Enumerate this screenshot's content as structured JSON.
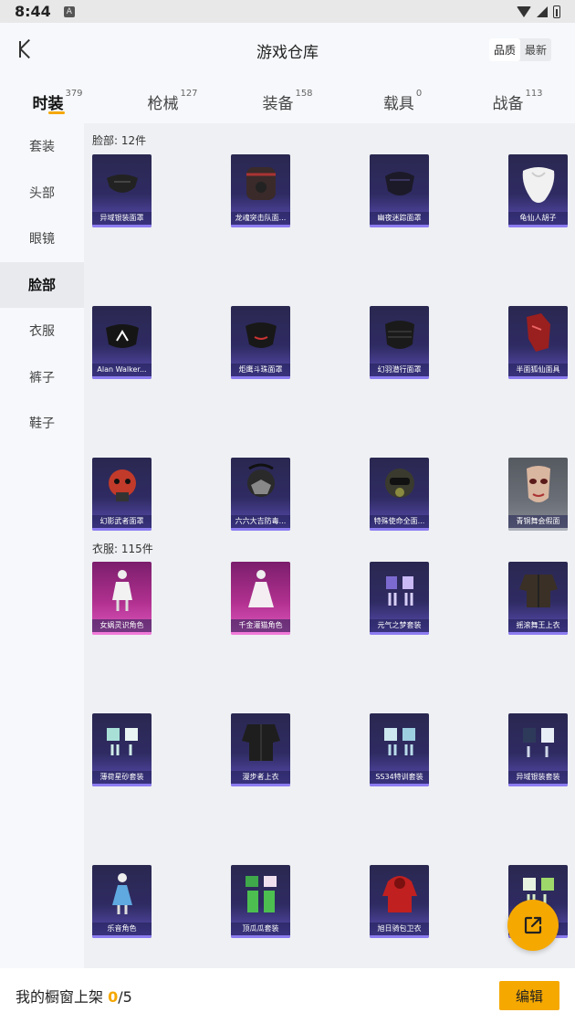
{
  "status": {
    "time": "8:44",
    "a_icon": "A"
  },
  "header": {
    "title": "游戏仓库",
    "sort_quality": "品质",
    "sort_newest": "最新"
  },
  "tabs": [
    {
      "label": "时装",
      "count": "379",
      "active": true
    },
    {
      "label": "枪械",
      "count": "127",
      "active": false
    },
    {
      "label": "装备",
      "count": "158",
      "active": false
    },
    {
      "label": "载具",
      "count": "0",
      "active": false
    },
    {
      "label": "战备",
      "count": "113",
      "active": false
    }
  ],
  "sidebar": [
    "套装",
    "头部",
    "眼镜",
    "脸部",
    "衣服",
    "裤子",
    "鞋子"
  ],
  "sidebar_active": "脸部",
  "sections": [
    {
      "title": "脸部: 12件"
    },
    {
      "title": "衣服: 115件"
    }
  ],
  "face_items": [
    {
      "name": "异域银装面罩",
      "icon": "black-half-mask",
      "rarity": "purple"
    },
    {
      "name": "龙魂突击队面...",
      "icon": "red-black-mask",
      "rarity": "purple"
    },
    {
      "name": "幽夜迷踪面罩",
      "icon": "dark-ninja-mask",
      "rarity": "purple"
    },
    {
      "name": "龟仙人胡子",
      "icon": "white-beard",
      "rarity": "purple"
    },
    {
      "name": "Alan Walker...",
      "icon": "alan-walker-mask",
      "rarity": "purple"
    },
    {
      "name": "炬鹰斗珠面罩",
      "icon": "black-red-mask",
      "rarity": "purple"
    },
    {
      "name": "幻羽潜行面罩",
      "icon": "black-cloth-mask",
      "rarity": "purple"
    },
    {
      "name": "半面狐仙面具",
      "icon": "red-fox-mask",
      "rarity": "purple"
    },
    {
      "name": "幻影武者面罩",
      "icon": "red-samurai-mask",
      "rarity": "purple"
    },
    {
      "name": "六六大吉防毒...",
      "icon": "gas-mask",
      "rarity": "purple"
    },
    {
      "name": "特殊使命全面...",
      "icon": "helmet-mask",
      "rarity": "purple"
    },
    {
      "name": "青铜舞会假面",
      "icon": "masquerade-mask",
      "rarity": "gray"
    }
  ],
  "clothes_items": [
    {
      "name": "女娲灵识角色",
      "icon": "white-character",
      "rarity": "pink"
    },
    {
      "name": "千金灌猫角色",
      "icon": "white-dress-character",
      "rarity": "pink"
    },
    {
      "name": "元气之梦套装",
      "icon": "purple-outfit",
      "rarity": "purple"
    },
    {
      "name": "摇滚舞王上衣",
      "icon": "dark-jacket",
      "rarity": "purple"
    },
    {
      "name": "薄荷星砂套装",
      "icon": "mint-outfit",
      "rarity": "purple"
    },
    {
      "name": "漫步者上衣",
      "icon": "black-jacket",
      "rarity": "purple"
    },
    {
      "name": "SS34特训套装",
      "icon": "blue-outfit",
      "rarity": "purple"
    },
    {
      "name": "异域银装套装",
      "icon": "navy-outfit",
      "rarity": "purple"
    },
    {
      "name": "乐音角色",
      "icon": "blue-dress-character",
      "rarity": "purple"
    },
    {
      "name": "顶瓜瓜套装",
      "icon": "green-outfit",
      "rarity": "purple"
    },
    {
      "name": "旭日骑包卫衣",
      "icon": "red-hoodie",
      "rarity": "purple"
    },
    {
      "name": "",
      "icon": "green-white-outfit",
      "rarity": "purple"
    }
  ],
  "footer": {
    "prefix": "我的橱窗上架 ",
    "current": "0",
    "sep": "/",
    "total": "5",
    "edit_label": "编辑"
  },
  "colors": {
    "accent": "#f5a800",
    "purple_card": "#2e2a5e",
    "pink_card": "#b0308f",
    "gray_card": "#666a72"
  }
}
